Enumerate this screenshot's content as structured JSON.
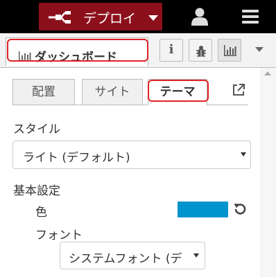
{
  "header": {
    "deploy_label": "デプロイ",
    "deploy_icon": "deploy-icon",
    "user_icon": "user-icon",
    "menu_icon": "hamburger-menu-icon"
  },
  "sidebar": {
    "active_tab": {
      "label": "ダッシュボード",
      "icon": "bar-chart-icon"
    },
    "buttons": [
      {
        "name": "info-button",
        "glyph": "i"
      },
      {
        "name": "debug-button",
        "icon": "bug-icon"
      },
      {
        "name": "dashboard-button",
        "icon": "bar-chart-icon"
      }
    ]
  },
  "dashboard": {
    "tabs": [
      {
        "label": "配置",
        "active": false
      },
      {
        "label": "サイト",
        "active": false
      },
      {
        "label": "テーマ",
        "active": true
      }
    ],
    "style": {
      "label": "スタイル",
      "selected": "ライト (デフォルト)"
    },
    "base_settings": {
      "label": "基本設定",
      "color_label": "色",
      "color_value": "#0094ce",
      "font_label": "フォント",
      "font_selected": "システムフォント (デ"
    }
  },
  "colors": {
    "header_bg": "#000000",
    "deploy_bg": "#8c101c",
    "highlight": "#e02127"
  }
}
